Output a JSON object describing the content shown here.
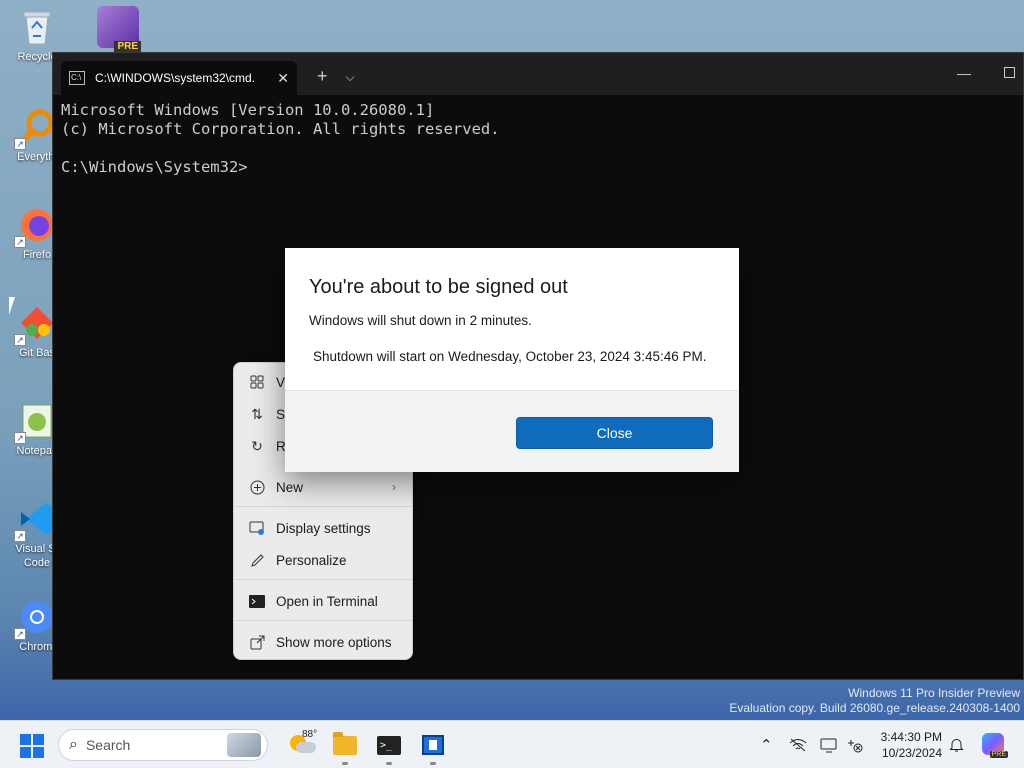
{
  "desktop": {
    "icons": [
      {
        "label": "Recycle",
        "icon": "recycle-bin-icon"
      },
      {
        "label": "Everythi",
        "icon": "everything-search-icon"
      },
      {
        "label": "Firefo",
        "icon": "firefox-icon"
      },
      {
        "label": "Git Bas",
        "icon": "git-bash-icon"
      },
      {
        "label": "Notepac",
        "icon": "notepad-plus-icon"
      },
      {
        "label": "Visual St\nCode",
        "icon": "vscode-icon"
      },
      {
        "label": "Chromi",
        "icon": "chromium-icon"
      }
    ],
    "top_app_badge": "PRE"
  },
  "terminal": {
    "tab_title": "C:\\WINDOWS\\system32\\cmd.",
    "new_tab_glyph": "+",
    "dropdown_glyph": "⌵",
    "minimize_glyph": "—",
    "lines": [
      "Microsoft Windows [Version 10.0.26080.1]",
      "(c) Microsoft Corporation. All rights reserved.",
      "",
      "C:\\Windows\\System32>"
    ]
  },
  "context_menu": {
    "items": [
      {
        "label": "V",
        "icon": "view-grid-icon"
      },
      {
        "label": "S",
        "icon": "sort-icon"
      },
      {
        "label": "R",
        "icon": "refresh-icon"
      },
      {
        "label": "New",
        "icon": "new-plus-icon",
        "submenu": true
      },
      {
        "label": "Display settings",
        "icon": "display-settings-icon"
      },
      {
        "label": "Personalize",
        "icon": "pen-icon"
      },
      {
        "label": "Open in Terminal",
        "icon": "terminal-icon"
      },
      {
        "label": "Show more options",
        "icon": "open-external-icon"
      }
    ]
  },
  "dialog": {
    "title": "You're about to be signed out",
    "message": "Windows will shut down in 2 minutes.",
    "detail": "Shutdown will start on Wednesday, October 23, 2024 3:45:46 PM.",
    "close_label": "Close"
  },
  "watermark": {
    "line1": "Windows 11 Pro Insider Preview",
    "line2": "Evaluation copy. Build 26080.ge_release.240308-1400"
  },
  "taskbar": {
    "search_placeholder": "Search",
    "weather_temp": "88°",
    "time": "3:44:30 PM",
    "date": "10/23/2024",
    "copilot_badge": "PRE",
    "accent": "#1a73e8"
  }
}
